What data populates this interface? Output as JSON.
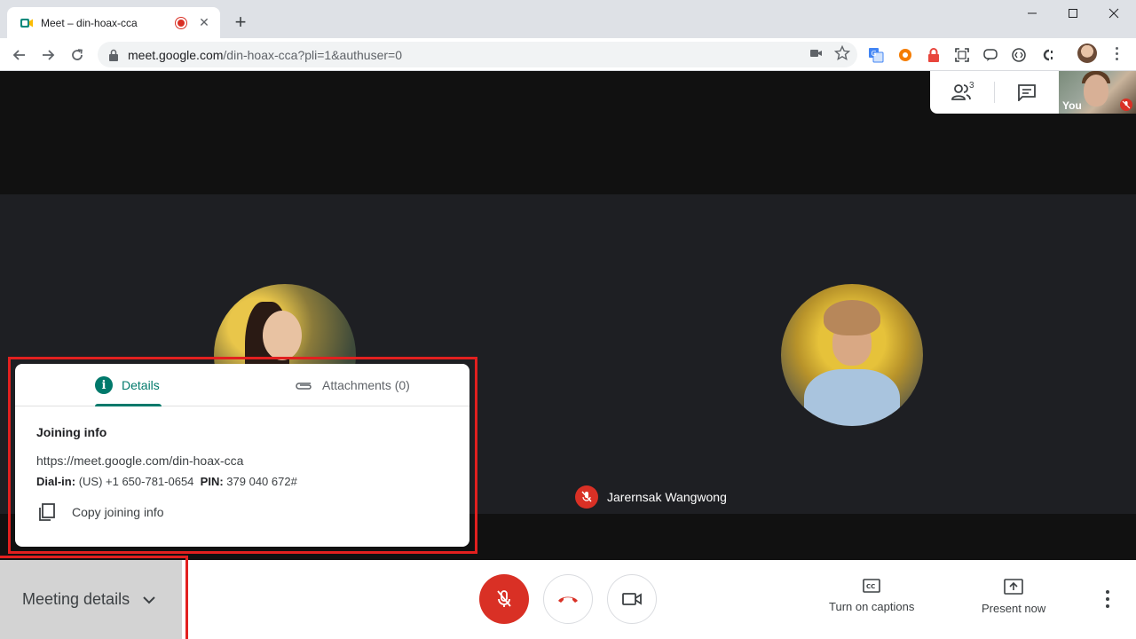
{
  "browser": {
    "tab_title": "Meet – din-hoax-cca",
    "tab_close": "✕",
    "new_tab": "+",
    "url_host": "meet.google.com",
    "url_path": "/din-hoax-cca?pli=1&authuser=0"
  },
  "meet": {
    "self_label": "You",
    "people_count": "3",
    "participant_name": "Jarernsak Wangwong"
  },
  "details_panel": {
    "tab_details": "Details",
    "tab_attachments": "Attachments (0)",
    "joining_title": "Joining info",
    "joining_url": "https://meet.google.com/din-hoax-cca",
    "dialin_label": "Dial-in:",
    "dialin_number": "(US) +1 650-781-0654",
    "pin_label": "PIN:",
    "pin_value": "379 040 672#",
    "copy_label": "Copy joining info"
  },
  "bottombar": {
    "meeting_details": "Meeting details",
    "captions": "Turn on captions",
    "present": "Present now"
  },
  "colors": {
    "accent_teal": "#00796b",
    "danger_red": "#d93025",
    "highlight_red": "#e2201f"
  }
}
